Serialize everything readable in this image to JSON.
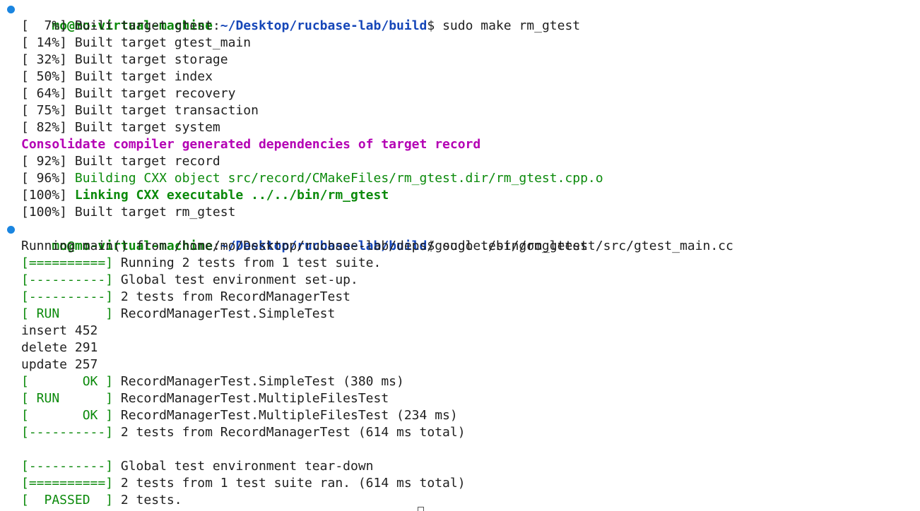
{
  "prompt": {
    "user_host": "mo@mo-virtual-machine",
    "colon": ":",
    "path": "~/Desktop/rucbase-lab/build",
    "dollar": "$ "
  },
  "commands": {
    "first": "sudo make rm_gtest",
    "second": "sudo ./bin/rm_gtest"
  },
  "build": {
    "l1": "[  7%] Built target gtest",
    "l2": "[ 14%] Built target gtest_main",
    "l3": "[ 32%] Built target storage",
    "l4": "[ 50%] Built target index",
    "l5": "[ 64%] Built target recovery",
    "l6": "[ 75%] Built target transaction",
    "l7": "[ 82%] Built target system",
    "consolidate": "Consolidate compiler generated dependencies of target record",
    "l8": "[ 92%] Built target record",
    "l9_prefix": "[ 96%] ",
    "l9_text": "Building CXX object src/record/CMakeFiles/rm_gtest.dir/rm_gtest.cpp.o",
    "l10_prefix": "[100%] ",
    "l10_text": "Linking CXX executable ../../bin/rm_gtest",
    "l11": "[100%] Built target rm_gtest"
  },
  "test": {
    "running_main": "Running main() from /home/mo/Desktop/rucbase-lab/deps/googletest/googletest/src/gtest_main.cc",
    "t1_tag": "[==========]",
    "t1_text": " Running 2 tests from 1 test suite.",
    "t2_tag": "[----------]",
    "t2_text": " Global test environment set-up.",
    "t3_tag": "[----------]",
    "t3_text": " 2 tests from RecordManagerTest",
    "t4_tag": "[ RUN      ]",
    "t4_text": " RecordManagerTest.SimpleTest",
    "insert": "insert 452",
    "delete": "delete 291",
    "update": "update 257",
    "t5_tag": "[       OK ]",
    "t5_text": " RecordManagerTest.SimpleTest (380 ms)",
    "t6_tag": "[ RUN      ]",
    "t6_text": " RecordManagerTest.MultipleFilesTest",
    "t7_tag": "[       OK ]",
    "t7_text": " RecordManagerTest.MultipleFilesTest (234 ms)",
    "t8_tag": "[----------]",
    "t8_text": " 2 tests from RecordManagerTest (614 ms total)",
    "t9_tag": "[----------]",
    "t9_text": " Global test environment tear-down",
    "t10_tag": "[==========]",
    "t10_text": " 2 tests from 1 test suite ran. (614 ms total)",
    "t11_tag": "[  PASSED  ]",
    "t11_text": " 2 tests."
  },
  "colors": {
    "prompt_user": "#0b8a0b",
    "prompt_path": "#1546b8",
    "status_dot": "#1a85e0",
    "gtest_green": "#0b8a0b",
    "consolidate_magenta": "#b400b4"
  }
}
